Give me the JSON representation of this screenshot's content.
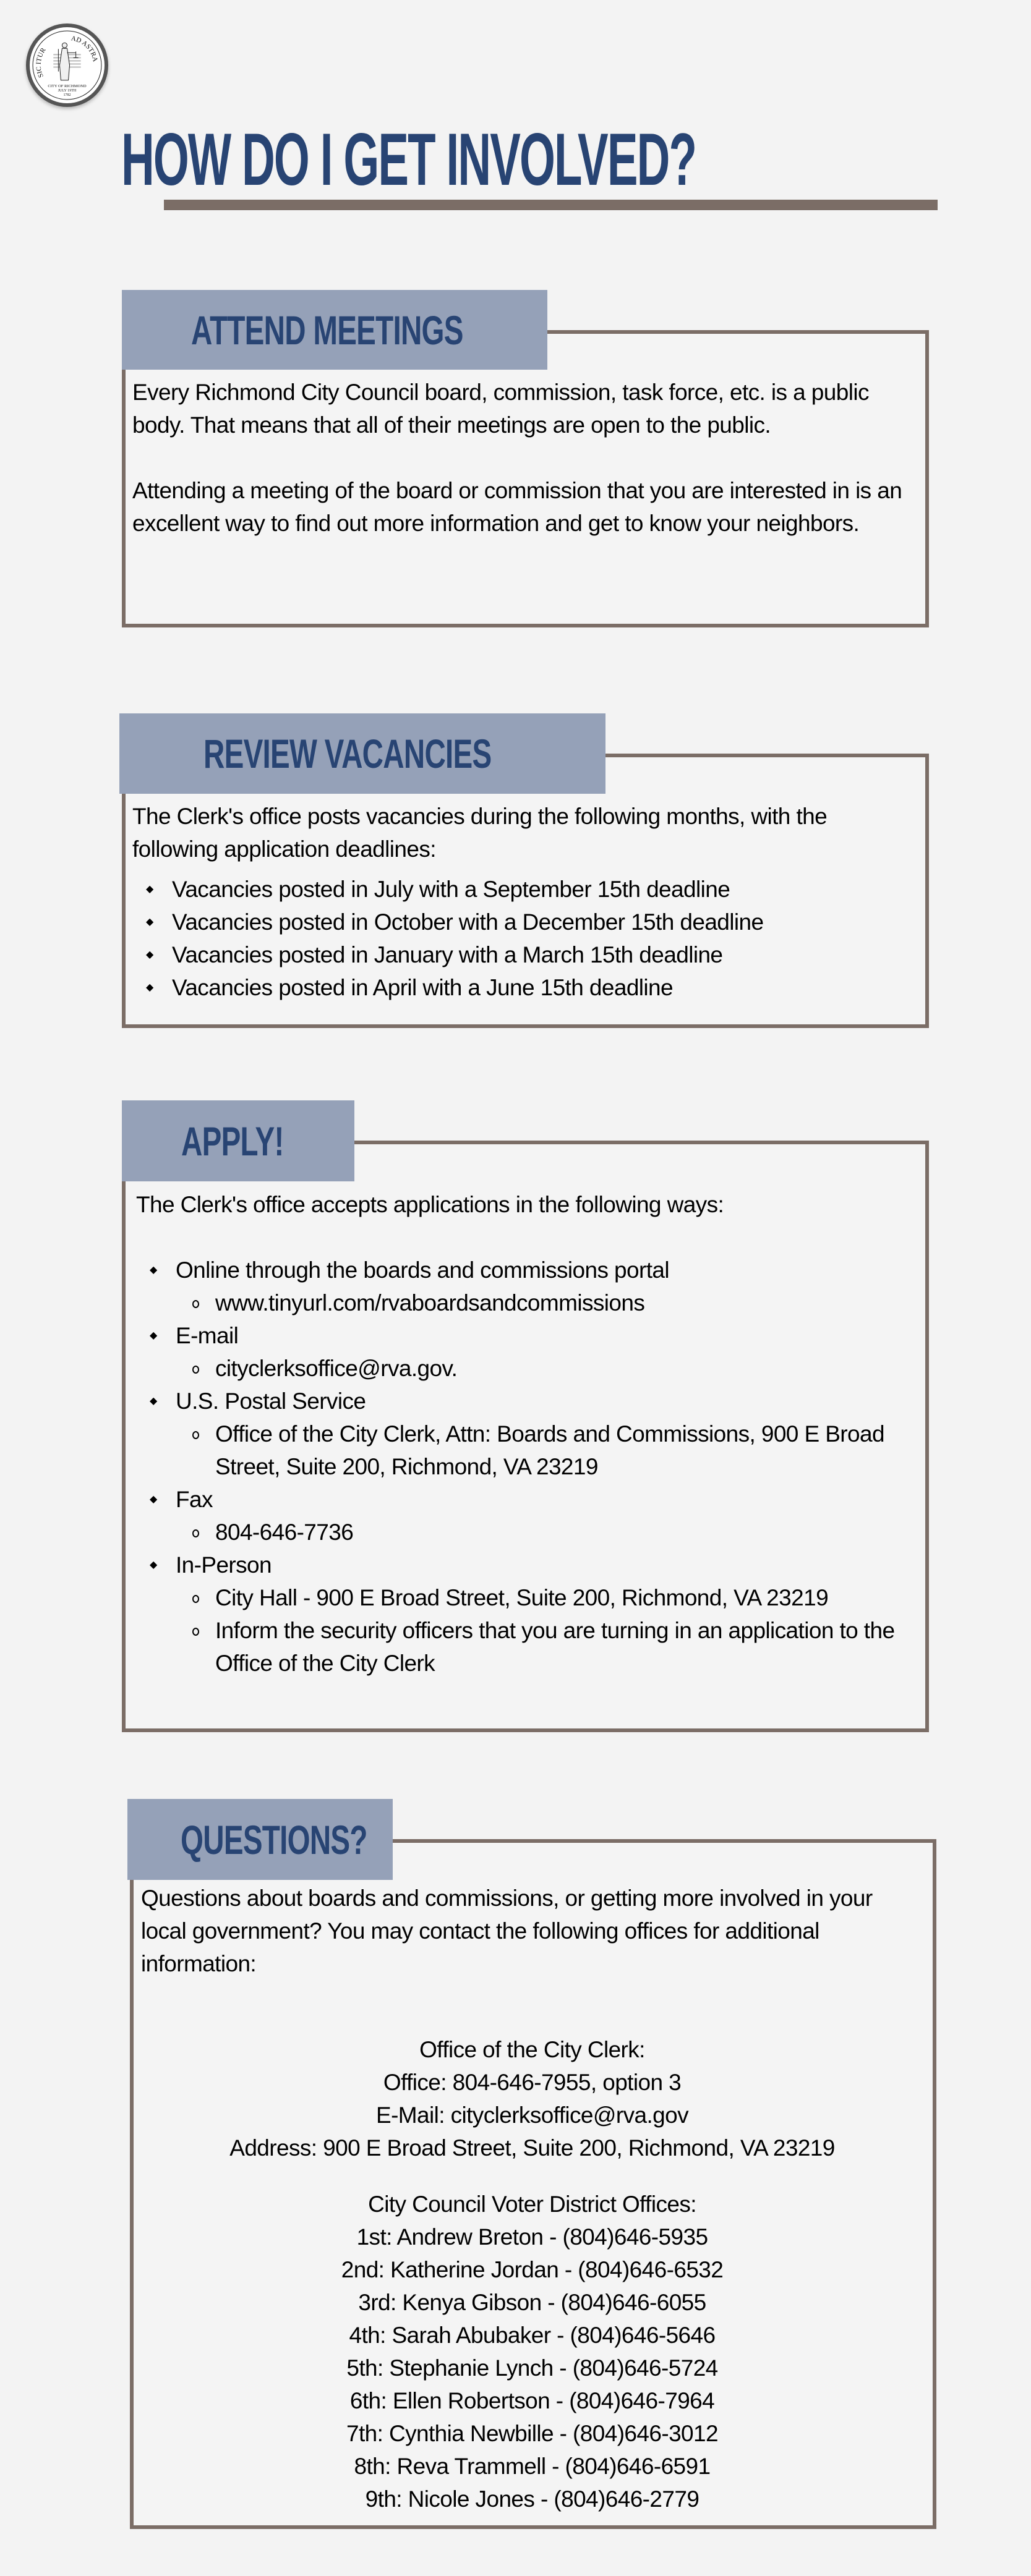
{
  "seal": {
    "motto_left": "SIC ITUR",
    "motto_right": "AD ASTRA",
    "line1": "CITY OF RICHMOND",
    "line2": "JULY 19TH",
    "line3": "1782"
  },
  "title": "HOW DO I GET INVOLVED?",
  "colors": {
    "title": "#284473",
    "tab_bg": "#95a1b8",
    "border": "#7b6d66",
    "background": "#f3f3f3"
  },
  "sections": {
    "attend": {
      "heading": "ATTEND MEETINGS",
      "paragraphs": [
        "Every Richmond City Council board, commission, task force, etc. is a public body. That means that all of their meetings are open to the public.",
        "Attending a meeting of the board or commission that you are interested in is an excellent way to find out more information and get to know your neighbors."
      ]
    },
    "vacancies": {
      "heading": "REVIEW VACANCIES",
      "intro": "The Clerk's office posts vacancies during the following months, with the following application deadlines:",
      "items": [
        "Vacancies posted in July with a September 15th deadline",
        "Vacancies posted in October with a December 15th deadline",
        "Vacancies posted in January with a March 15th deadline",
        "Vacancies posted in April with a June 15th  deadline"
      ]
    },
    "apply": {
      "heading": "APPLY!",
      "intro": "The Clerk's office accepts applications in the following ways:",
      "methods": [
        {
          "label": "Online through the boards and commissions portal",
          "details": [
            "www.tinyurl.com/rvaboardsandcommissions"
          ]
        },
        {
          "label": "E-mail",
          "details": [
            "cityclerksoffice@rva.gov."
          ]
        },
        {
          "label": "U.S.  Postal Service",
          "details": [
            "Office of the City Clerk, Attn: Boards and Commissions, 900 E Broad Street, Suite 200, Richmond, VA 23219"
          ]
        },
        {
          "label": "Fax",
          "details": [
            "804-646-7736"
          ]
        },
        {
          "label": "In-Person",
          "details": [
            "City Hall - 900 E Broad Street, Suite 200, Richmond, VA 23219",
            "Inform the security officers that you are turning in an application to the Office of the City  Clerk"
          ]
        }
      ]
    },
    "questions": {
      "heading": "QUESTIONS?",
      "intro": "Questions about boards and commissions, or getting more involved in your local government? You may contact the following offices for additional information:",
      "clerk": {
        "heading": "Office of the City Clerk:",
        "office": "Office:  804-646-7955, option 3",
        "email": "E-Mail:  cityclerksoffice@rva.gov",
        "address": "Address: 900 E Broad Street, Suite 200, Richmond, VA 23219"
      },
      "districts": {
        "heading": "City Council Voter District Offices:",
        "items": [
          "1st: Andrew Breton - (804)646-5935",
          "2nd: Katherine Jordan - (804)646-6532",
          "3rd: Kenya Gibson - (804)646-6055",
          "4th: Sarah Abubaker - (804)646-5646",
          "5th: Stephanie Lynch - (804)646-5724",
          "6th: Ellen Robertson - (804)646-7964",
          "7th: Cynthia Newbille - (804)646-3012",
          "8th: Reva Trammell - (804)646-6591",
          "9th: Nicole Jones - (804)646-2779"
        ]
      }
    }
  }
}
